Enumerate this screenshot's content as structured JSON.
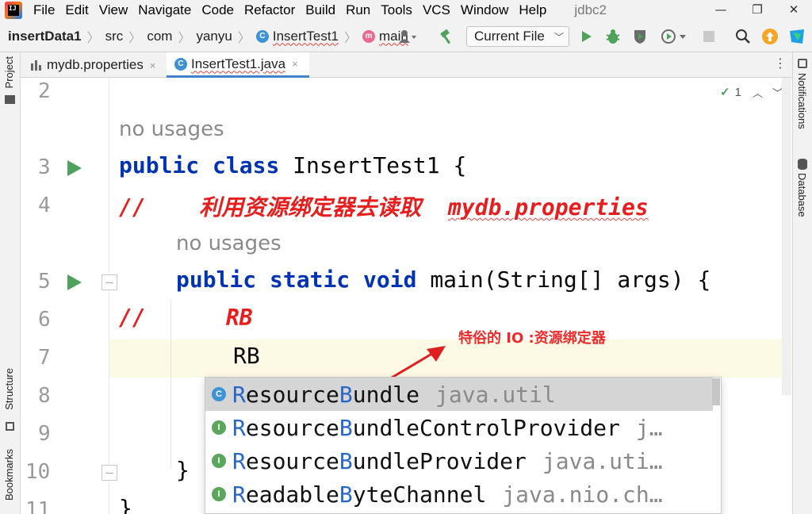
{
  "menu": {
    "logo": "IJ",
    "items": [
      "File",
      "Edit",
      "View",
      "Navigate",
      "Code",
      "Refactor",
      "Build",
      "Run",
      "Tools",
      "VCS",
      "Window",
      "Help"
    ],
    "project_name": "jdbc2"
  },
  "window_controls": {
    "minimize": "—",
    "restore": "❐",
    "close": "✕"
  },
  "breadcrumbs": {
    "project": "insertData1",
    "items": [
      "src",
      "com",
      "yanyu"
    ],
    "class_name": "InsertTest1",
    "method_name": "main",
    "class_icon_letter": "C",
    "method_icon_letter": "m"
  },
  "toolbar": {
    "run_config": "Current File",
    "icons": [
      "user-icon",
      "build-hammer-icon",
      "run-icon",
      "debug-icon",
      "coverage-icon",
      "profile-icon",
      "stop-icon",
      "search-icon",
      "update-icon",
      "toolbox-icon"
    ]
  },
  "left_strip": {
    "top": "Project",
    "bottom1": "Structure",
    "bottom2": "Bookmarks"
  },
  "right_strip": {
    "top": "Notifications",
    "middle": "Database"
  },
  "tabs": [
    {
      "label": "mydb.properties",
      "close": "×",
      "active": false
    },
    {
      "label": "InsertTest1.java",
      "close": "×",
      "active": true
    }
  ],
  "inspections": {
    "count": "1",
    "check": "✓",
    "up": "︿",
    "down": "﹀"
  },
  "editor": {
    "line_numbers": [
      "2",
      "3",
      "4",
      "5",
      "6",
      "7",
      "8",
      "9",
      "10",
      "11"
    ],
    "hint_class": "no usages",
    "hint_method": "no usages",
    "line3": {
      "kw1": "public",
      "kw2": "class",
      "rest": "InsertTest1 {"
    },
    "line4": {
      "slashes": "//",
      "comment": "利用资源绑定器去读取",
      "file": "mydb.properties"
    },
    "line5": {
      "kw1": "public",
      "kw2": "static",
      "kw3": "void",
      "rest": "main(String[] args) {"
    },
    "line6": {
      "slashes": "//",
      "comment": "RB"
    },
    "line7": {
      "text": "RB"
    },
    "line10": {
      "text": "}"
    },
    "line11": {
      "text": "}"
    }
  },
  "annotation": "特俗的  IO :资源绑定器",
  "completion": {
    "items": [
      {
        "match1": "R",
        "mid1": "esource",
        "match2": "B",
        "rest": "undle",
        "pkg": "java.util",
        "icon": "C",
        "icon_color": "#3e92d6",
        "selected": true
      },
      {
        "match1": "R",
        "mid1": "esource",
        "match2": "B",
        "rest": "undleControlProvider",
        "pkg": "j…",
        "icon": "I",
        "icon_color": "#5aa65c",
        "selected": false
      },
      {
        "match1": "R",
        "mid1": "esource",
        "match2": "B",
        "rest": "undleProvider",
        "pkg": "java.uti…",
        "icon": "I",
        "icon_color": "#5aa65c",
        "selected": false
      },
      {
        "match1": "R",
        "mid1": "eadable",
        "match2": "B",
        "rest": "yteChannel",
        "pkg": "java.nio.ch…",
        "icon": "I",
        "icon_color": "#5aa65c",
        "selected": false
      }
    ]
  },
  "colors": {
    "keyword": "#0033b3",
    "comment": "#e61e1e",
    "match": "#2867c9",
    "caret_row": "#fcf9e5",
    "annotation": "#ee2a2a"
  }
}
